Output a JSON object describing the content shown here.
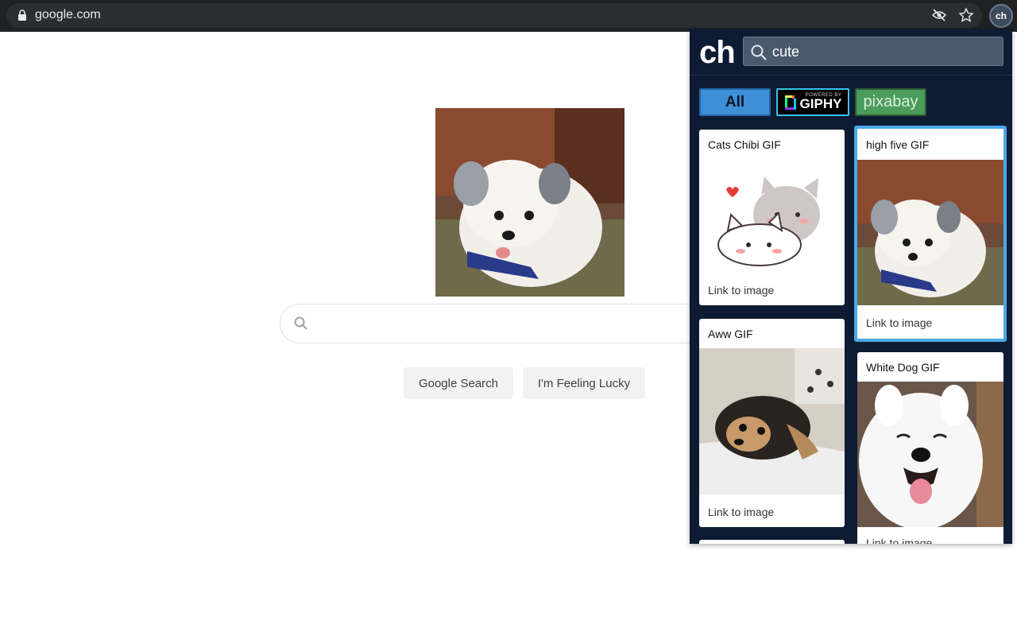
{
  "browser": {
    "url": "google.com",
    "extension_label": "ch"
  },
  "google": {
    "search_placeholder": "",
    "buttons": {
      "search": "Google Search",
      "lucky": "I'm Feeling Lucky"
    }
  },
  "panel": {
    "logo": "ch",
    "search_value": "cute",
    "filters": {
      "all": "All",
      "giphy_small": "POWERED BY",
      "giphy_word": "GIPHY",
      "pixabay": "pixabay"
    },
    "results": [
      {
        "title": "Cats Chibi GIF",
        "link": "Link to image"
      },
      {
        "title": "high five GIF",
        "link": "Link to image"
      },
      {
        "title": "Aww GIF",
        "link": "Link to image"
      },
      {
        "title": "White Dog GIF",
        "link": "Link to image"
      }
    ]
  },
  "colors": {
    "panel_bg": "#0d1b33",
    "accent": "#4aa8e8",
    "topbar": "#202124"
  }
}
